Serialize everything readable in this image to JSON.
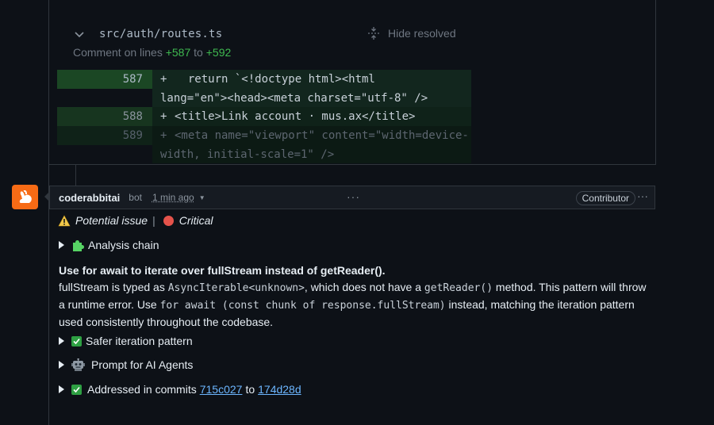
{
  "file": {
    "path": "src/auth/routes.ts",
    "hide_resolved": "Hide resolved",
    "comment_prefix": "Comment on lines",
    "line_start": "+587",
    "line_to": "to",
    "line_end": "+592"
  },
  "diff": [
    {
      "line": "587",
      "sign": "+",
      "code": "  return `<!doctype html><html\nlang=\"en\"><head><meta charset=\"utf-8\" />"
    },
    {
      "line": "588",
      "sign": "+",
      "code": "<title>Link account · mus.ax</title>"
    },
    {
      "line": "589",
      "sign": "+",
      "code": "<meta name=\"viewport\" content=\"width=device-\nwidth, initial-scale=1\" />"
    }
  ],
  "comment": {
    "author": "coderabbitai",
    "bot_label": "bot",
    "time": "1 min ago",
    "more": "···",
    "role_badge": "Contributor",
    "issue_label": "Potential issue",
    "severity_label": "Critical",
    "analysis_chain": "Analysis chain",
    "title": "Use for await to iterate over fullStream instead of getReader().",
    "para_1": "fullStream is typed as ",
    "para_code_1": "AsyncIterable<unknown>",
    "para_2": ", which does not have a ",
    "para_code_2": "getReader()",
    "para_3": " method. This pattern will throw a runtime error. Use ",
    "para_code_3": "for await (const chunk of response.fullStream)",
    "para_4": " instead, matching the iteration pattern used consistently throughout the codebase.",
    "safer_iteration": "Safer iteration pattern",
    "prompt_agents": "Prompt for AI Agents",
    "addressed_prefix": "Addressed in commits",
    "commit_from": "715c027",
    "commit_to_word": "to",
    "commit_to": "174d28d"
  },
  "colors": {
    "accent_orange": "#f76b15",
    "added_green": "#3fb950",
    "critical_red": "#e5534b",
    "link_blue": "#6cb6ff"
  },
  "icons": [
    "chevron-down-icon",
    "collapse-icon",
    "rabbit-icon",
    "warning-icon",
    "red-circle-icon",
    "puzzle-icon",
    "check-icon",
    "robot-icon",
    "triangle-right-icon",
    "more-icon"
  ]
}
